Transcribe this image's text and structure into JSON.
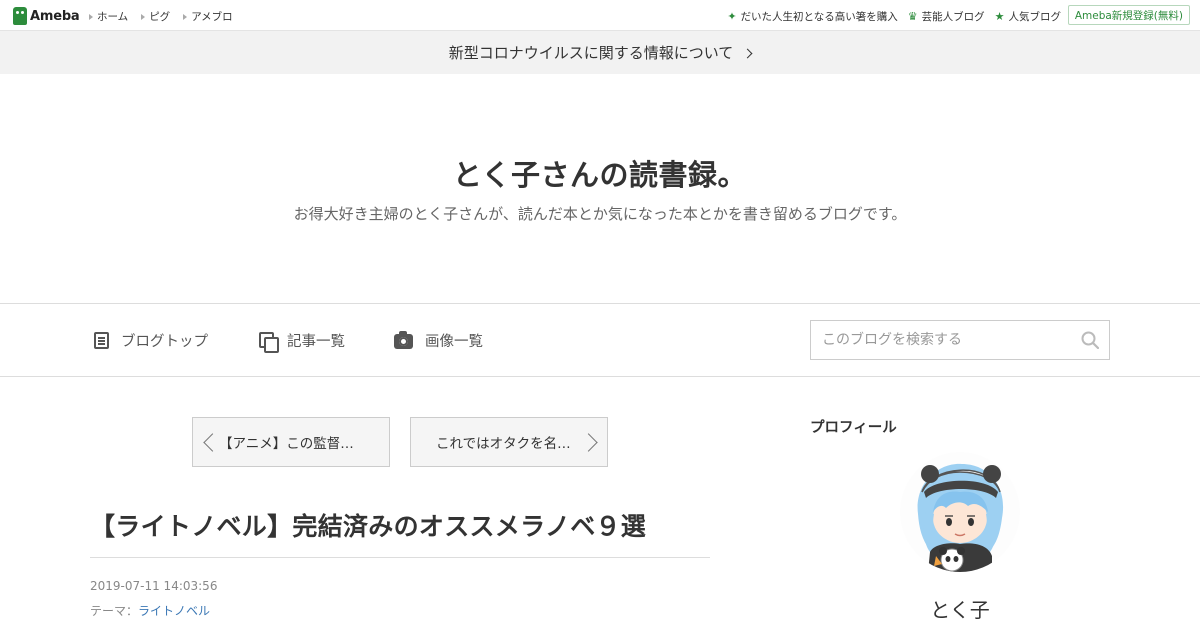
{
  "global_header": {
    "logo_text": "Ameba",
    "nav": [
      "ホーム",
      "ピグ",
      "アメブロ"
    ],
    "right_links": [
      {
        "label": "だいた人生初となる高い箸を購入",
        "icon": "sparkle-icon"
      },
      {
        "label": "芸能人ブログ",
        "icon": "crown-icon"
      },
      {
        "label": "人気ブログ",
        "icon": "star-icon"
      }
    ],
    "register_label": "Ameba新規登録(無料)",
    "accent_color": "#2d8c3c"
  },
  "notice": {
    "text": "新型コロナウイルスに関する情報について"
  },
  "blog": {
    "title": "とく子さんの読書録。",
    "description": "お得大好き主婦のとく子さんが、読んだ本とか気になった本とかを書き留めるブログです。"
  },
  "blog_nav": {
    "items": [
      {
        "label": "ブログトップ",
        "icon": "list-icon"
      },
      {
        "label": "記事一覧",
        "icon": "copy-icon"
      },
      {
        "label": "画像一覧",
        "icon": "camera-icon"
      }
    ],
    "search_placeholder": "このブログを検索する"
  },
  "pager": {
    "prev_label": "【アニメ】この監督…",
    "next_label": "これではオタクを名…"
  },
  "entry": {
    "title": "【ライトノベル】完結済みのオススメラノベ９選",
    "date": "2019-07-11 14:03:56",
    "theme_prefix": "テーマ：",
    "theme": "ライトノベル",
    "link_color": "#3c78b5"
  },
  "sidebar": {
    "heading": "プロフィール",
    "profile_name": "とく子"
  }
}
